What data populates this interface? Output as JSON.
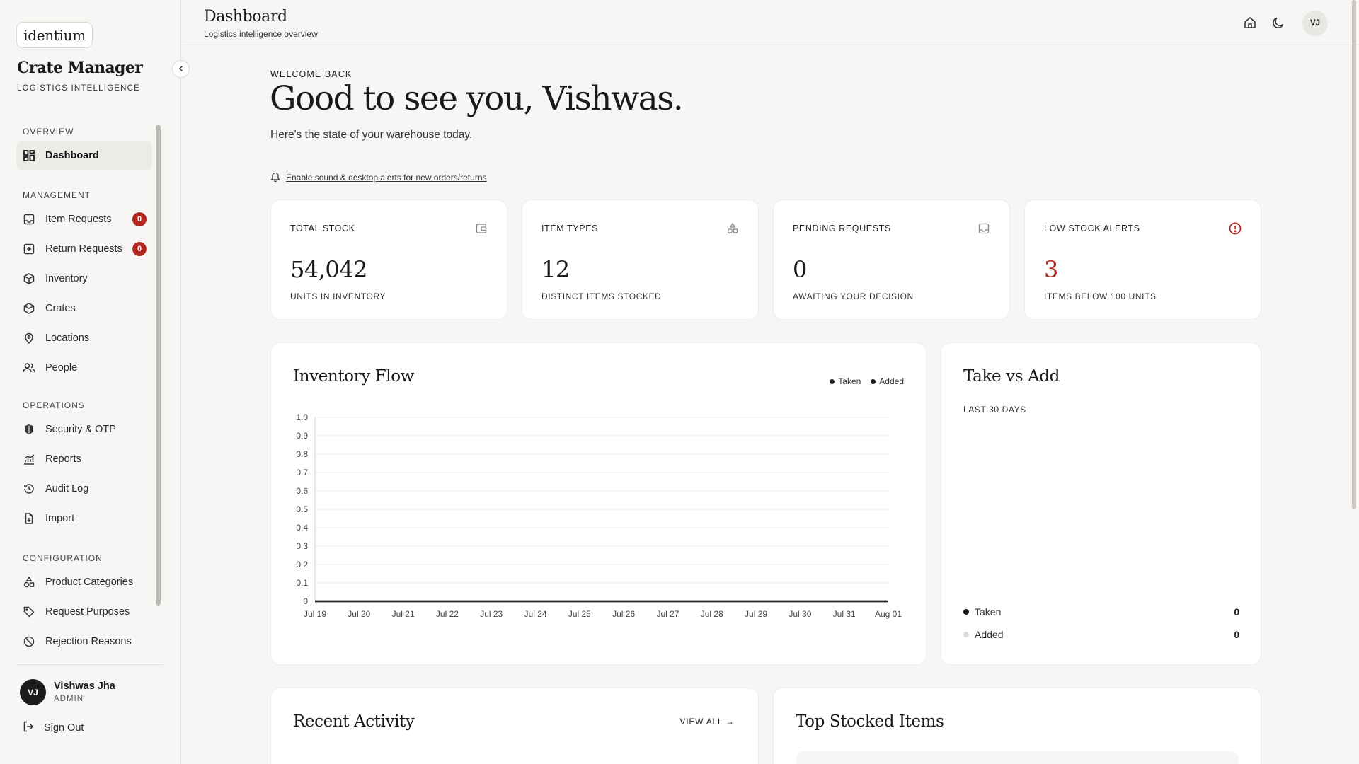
{
  "sidebar": {
    "logo": "identium",
    "app_title": "Crate Manager",
    "app_subtitle": "LOGISTICS INTELLIGENCE",
    "sections": [
      {
        "title": "OVERVIEW",
        "items": [
          {
            "label": "Dashboard",
            "icon": "dashboard-grid-icon",
            "active": true
          }
        ]
      },
      {
        "title": "MANAGEMENT",
        "items": [
          {
            "label": "Item Requests",
            "icon": "inbox-icon",
            "badge": "0"
          },
          {
            "label": "Return Requests",
            "icon": "return-box-icon",
            "badge": "0"
          },
          {
            "label": "Inventory",
            "icon": "package-icon"
          },
          {
            "label": "Crates",
            "icon": "crate-icon"
          },
          {
            "label": "Locations",
            "icon": "map-pin-icon"
          },
          {
            "label": "People",
            "icon": "users-icon"
          }
        ]
      },
      {
        "title": "OPERATIONS",
        "items": [
          {
            "label": "Security & OTP",
            "icon": "shield-icon"
          },
          {
            "label": "Reports",
            "icon": "chart-icon"
          },
          {
            "label": "Audit Log",
            "icon": "history-icon"
          },
          {
            "label": "Import",
            "icon": "import-file-icon"
          }
        ]
      },
      {
        "title": "CONFIGURATION",
        "items": [
          {
            "label": "Product Categories",
            "icon": "shapes-icon"
          },
          {
            "label": "Request Purposes",
            "icon": "tag-icon"
          },
          {
            "label": "Rejection Reasons",
            "icon": "ban-icon"
          }
        ]
      }
    ],
    "user": {
      "initials": "VJ",
      "name": "Vishwas Jha",
      "role": "ADMIN"
    },
    "signout_label": "Sign Out"
  },
  "header": {
    "title": "Dashboard",
    "subtitle": "Logistics intelligence overview",
    "avatar_initials": "VJ",
    "icons": [
      "home-icon",
      "moon-icon"
    ]
  },
  "main": {
    "welcome": "WELCOME BACK",
    "greeting": "Good to see you, Vishwas.",
    "greeting_sub": "Here's the state of your warehouse today.",
    "alert_link": "Enable sound & desktop alerts for new orders/returns",
    "stats": [
      {
        "label": "TOTAL STOCK",
        "value": "54,042",
        "caption": "UNITS IN INVENTORY",
        "icon": "wallet-icon",
        "alert": false
      },
      {
        "label": "ITEM TYPES",
        "value": "12",
        "caption": "DISTINCT ITEMS STOCKED",
        "icon": "shapes-icon",
        "alert": false
      },
      {
        "label": "PENDING REQUESTS",
        "value": "0",
        "caption": "AWAITING YOUR DECISION",
        "icon": "inbox-icon",
        "alert": false
      },
      {
        "label": "LOW STOCK ALERTS",
        "value": "3",
        "caption": "ITEMS BELOW 100 UNITS",
        "icon": "alert-circle-icon",
        "alert": true
      }
    ],
    "inventory_flow": {
      "title": "Inventory Flow",
      "legend": [
        "Taken",
        "Added"
      ]
    },
    "take_vs_add": {
      "title": "Take vs Add",
      "subtitle": "LAST 30 DAYS",
      "rows": [
        {
          "label": "Taken",
          "value": "0",
          "color": "#1a1a1a"
        },
        {
          "label": "Added",
          "value": "0",
          "color": "#dddad6"
        }
      ]
    },
    "recent_activity": {
      "title": "Recent Activity",
      "view_all": "VIEW ALL →"
    },
    "top_stocked": {
      "title": "Top Stocked Items"
    }
  },
  "chart_data": {
    "type": "line",
    "x": [
      "Jul 19",
      "Jul 20",
      "Jul 21",
      "Jul 22",
      "Jul 23",
      "Jul 24",
      "Jul 25",
      "Jul 26",
      "Jul 27",
      "Jul 28",
      "Jul 29",
      "Jul 30",
      "Jul 31",
      "Aug 01"
    ],
    "series": [
      {
        "name": "Taken",
        "values": [
          0,
          0,
          0,
          0,
          0,
          0,
          0,
          0,
          0,
          0,
          0,
          0,
          0,
          0
        ]
      },
      {
        "name": "Added",
        "values": [
          0,
          0,
          0,
          0,
          0,
          0,
          0,
          0,
          0,
          0,
          0,
          0,
          0,
          0
        ]
      }
    ],
    "yticks": [
      "1.0",
      "0.9",
      "0.8",
      "0.7",
      "0.6",
      "0.5",
      "0.4",
      "0.3",
      "0.2",
      "0.1",
      "0"
    ],
    "ylim": [
      0,
      1
    ],
    "grid": true,
    "legend": "top-right"
  }
}
